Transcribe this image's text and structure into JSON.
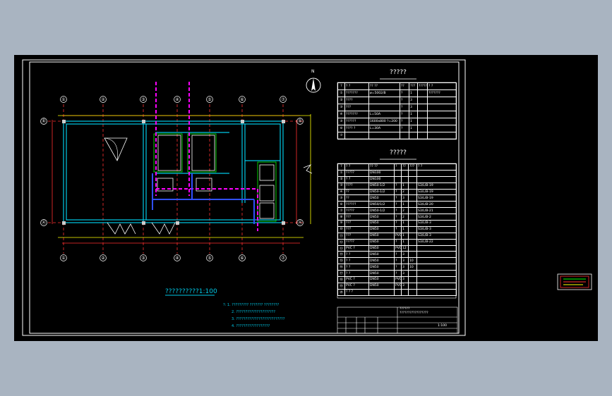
{
  "plan": {
    "title": "??????????1:100",
    "axes_top": [
      "①",
      "②",
      "③",
      "④",
      "⑤",
      "⑥",
      "⑦"
    ],
    "axes_bottom": [
      "①",
      "②",
      "③",
      "④",
      "⑤",
      "⑥",
      "⑦"
    ],
    "axes_left": [
      "Ⓑ",
      "Ⓐ"
    ],
    "axes_right": [
      "Ⓑ",
      "Ⓐ"
    ],
    "north": "N",
    "notes": [
      "?: 1. ????????? ??????? ????????",
      "2. ?????????????????????",
      "3. ??????????????????????????",
      "4. ??????????????????"
    ]
  },
  "table1": {
    "title": "?????",
    "headers": [
      "?",
      "? ?",
      "?? ??",
      "??",
      "???",
      "?????",
      "? ?"
    ],
    "rows": [
      [
        "①",
        "???????",
        "ø=5002/B",
        "?",
        "1",
        "",
        "???????"
      ],
      [
        "②",
        "????",
        "",
        "?",
        "3",
        "",
        ""
      ],
      [
        "③",
        "???",
        "",
        "?",
        "3",
        "",
        ""
      ],
      [
        "④",
        "???????",
        "L=50A",
        "?",
        "1",
        "",
        ""
      ],
      [
        "⑤",
        "??????",
        "1600x800 ?=200",
        "?",
        "1",
        "",
        ""
      ],
      [
        "⑥",
        "???? ?",
        "L=30A",
        "?",
        "1",
        "",
        ""
      ],
      [
        "⑦",
        "",
        "",
        "",
        "",
        "",
        ""
      ]
    ]
  },
  "table2": {
    "title": "?????",
    "headers": [
      "?",
      "? ?",
      "?? ??",
      "?",
      "??",
      "???",
      "? ?"
    ],
    "rows": [
      [
        "①",
        "?????",
        "DN100",
        "",
        "",
        "",
        ""
      ],
      [
        "②",
        "? ?",
        "DN100",
        "",
        "",
        "",
        ""
      ],
      [
        "③",
        "????",
        "DN50-1/2",
        "?",
        "1",
        "",
        "S3/L/B-19"
      ],
      [
        "④",
        "??",
        "DN50-1/2",
        "?",
        "2",
        "",
        "S3/L/B-19"
      ],
      [
        "⑤",
        "??",
        "DN50",
        "?",
        "3",
        "",
        "S3/L/B-19"
      ],
      [
        "⑥",
        "??????",
        "DN50/1/2",
        "?",
        "1",
        "",
        "S3/L/B-20"
      ],
      [
        "⑦",
        "?????",
        "DN50-1/2",
        "?",
        "2",
        "",
        "S3/L/B-21"
      ],
      [
        "⑧",
        "???",
        "DN50",
        "?",
        "2",
        "",
        "S3/L/B-2"
      ],
      [
        "⑨",
        "???",
        "DN50",
        "?",
        "1",
        "",
        "S3/L/B-3"
      ],
      [
        "⑩",
        "???",
        "DN50",
        "?",
        "1",
        "",
        "S3/L/B-3"
      ],
      [
        "⑪",
        "???",
        "DN50",
        "PVC",
        "1",
        "",
        "S3/L/B-3"
      ],
      [
        "⑫",
        "?????",
        "DN50",
        "?",
        "1",
        "",
        "S3/L/B-22"
      ],
      [
        "⑬",
        "PVC ?",
        "DN50",
        "PVC",
        "12",
        "",
        ""
      ],
      [
        "⑭",
        "? ?",
        "DN50",
        "?",
        "3",
        "",
        ""
      ],
      [
        "⑮",
        "? ?",
        "DN50",
        "?",
        "3",
        "10",
        ""
      ],
      [
        "⑯",
        "? ?",
        "DN50",
        "?",
        "3",
        "10",
        ""
      ],
      [
        "⑰",
        "? ?",
        "DN50",
        "?",
        "3",
        "",
        ""
      ],
      [
        "⑱",
        "PVC ?",
        "DN50",
        "PVC",
        "3",
        "",
        ""
      ],
      [
        "⑲",
        "PVC ?",
        "DN50",
        "PVC",
        "3",
        "",
        ""
      ],
      [
        "⑳",
        "? ? ?",
        "",
        "",
        "",
        "",
        ""
      ]
    ]
  },
  "title_block": {
    "project": "??????",
    "drawing": "?????????????????",
    "scale": "1:100",
    "rows": [
      [
        "??",
        "",
        "??",
        "",
        "??",
        "?????????????????"
      ],
      [
        "??",
        "",
        "??",
        "",
        "??",
        ""
      ],
      [
        "??",
        "",
        "??",
        "",
        "??",
        ""
      ]
    ]
  },
  "colors": {
    "background": "#a9b4c1",
    "canvas": "#000000",
    "frame": "#ffffff",
    "wall": "#00c8e6",
    "axis": "#ff3030",
    "pipe_magenta": "#ff00ff",
    "pipe_blue": "#3050ff",
    "yellow": "#ffff00",
    "green": "#00ff00",
    "text": "#ffffff"
  }
}
